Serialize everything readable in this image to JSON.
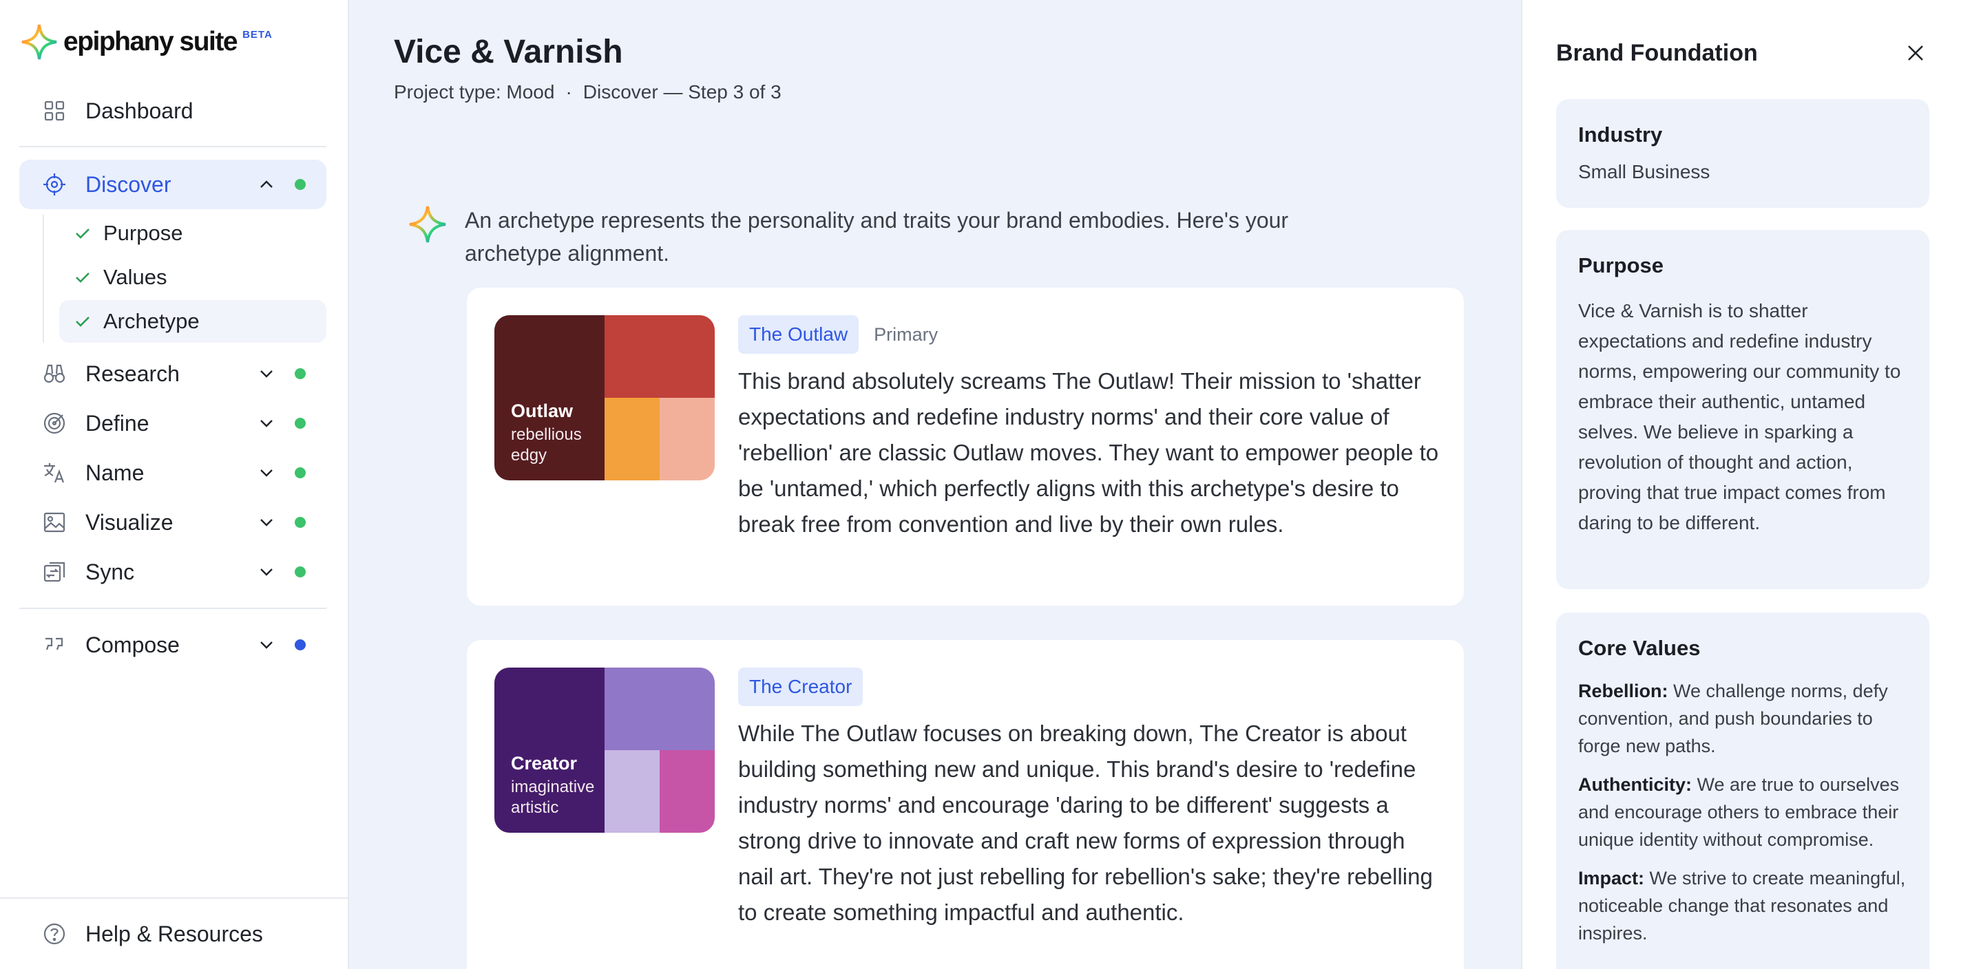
{
  "brand": {
    "logo_text": "epiphany suite",
    "beta": "BETA"
  },
  "sidebar": {
    "dashboard": "Dashboard",
    "discover": {
      "label": "Discover",
      "status_color": "#3cc26a"
    },
    "discover_subitems": [
      "Purpose",
      "Values",
      "Archetype"
    ],
    "sections": [
      {
        "label": "Research",
        "status_color": "#3cc26a"
      },
      {
        "label": "Define",
        "status_color": "#3cc26a"
      },
      {
        "label": "Name",
        "status_color": "#3cc26a"
      },
      {
        "label": "Visualize",
        "status_color": "#3cc26a"
      },
      {
        "label": "Sync",
        "status_color": "#3cc26a"
      }
    ],
    "compose": {
      "label": "Compose",
      "status_color": "#2f57e0"
    },
    "help": "Help & Resources"
  },
  "main": {
    "title": "Vice & Varnish",
    "project_type": "Project type: Mood",
    "step": "Discover — Step 3 of 3",
    "intro": "An archetype represents the personality and traits your brand embodies. Here's your archetype alignment.",
    "archetypes": [
      {
        "tag": "The Outlaw",
        "role": "Primary",
        "swatch_name": "Outlaw",
        "swatch_traits": [
          "rebellious",
          "edgy"
        ],
        "colors": [
          "#561d1f",
          "#c0403a",
          "#f2a13c",
          "#f2b09a"
        ],
        "text": "This brand absolutely screams The Outlaw! Their mission to 'shatter expectations and redefine industry norms' and their core value of 'rebellion' are classic Outlaw moves. They want to empower people to be 'untamed,' which perfectly aligns with this archetype's desire to break free from convention and live by their own rules."
      },
      {
        "tag": "The Creator",
        "role": "",
        "swatch_name": "Creator",
        "swatch_traits": [
          "imaginative",
          "artistic"
        ],
        "colors": [
          "#451c6b",
          "#9177c7",
          "#c7b7e3",
          "#c655a8"
        ],
        "text": "While The Outlaw focuses on breaking down, The Creator is about building something new and unique. This brand's desire to 'redefine industry norms' and encourage 'daring to be different' suggests a strong drive to innovate and craft new forms of expression through nail art. They're not just rebelling for rebellion's sake; they're rebelling to create something impactful and authentic."
      }
    ]
  },
  "panel": {
    "title": "Brand Foundation",
    "industry": {
      "heading": "Industry",
      "value": "Small Business"
    },
    "purpose": {
      "heading": "Purpose",
      "value": "Vice & Varnish is to shatter expectations and redefine industry norms, empowering our community to embrace their authentic, untamed selves. We believe in sparking a revolution of thought and action, proving that true impact comes from daring to be different."
    },
    "core_values": {
      "heading": "Core Values",
      "items": [
        {
          "name": "Rebellion:",
          "text": "We challenge norms, defy convention, and push boundaries to forge new paths."
        },
        {
          "name": "Authenticity:",
          "text": "We are true to ourselves and encourage others to embrace their unique identity without compromise."
        },
        {
          "name": "Impact:",
          "text": "We strive to create meaningful, noticeable change that resonates and inspires."
        }
      ]
    }
  },
  "colors": {
    "accent": "#2f57e0",
    "active_bg": "#e9effc",
    "status_green": "#3cc26a"
  }
}
